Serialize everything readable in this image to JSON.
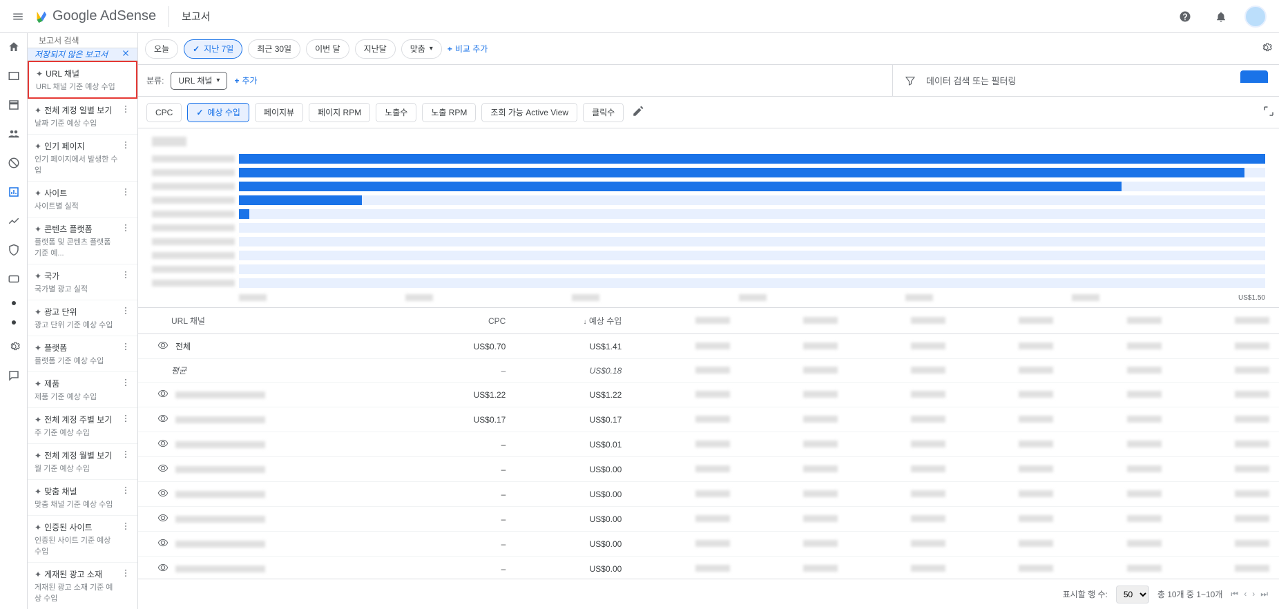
{
  "topbar": {
    "product": "Google AdSense",
    "page_title": "보고서"
  },
  "search": {
    "placeholder": "보고서 검색"
  },
  "unsaved": {
    "label": "저장되지 않은 보고서"
  },
  "reports": [
    {
      "name": "URL 채널",
      "sub": "URL 채널 기준 예상 수입",
      "highlight": true,
      "more": false
    },
    {
      "name": "전체 계정 일별 보기",
      "sub": "날짜 기준 예상 수입",
      "more": true
    },
    {
      "name": "인기 페이지",
      "sub": "인기 페이지에서 발생한 수입",
      "more": true
    },
    {
      "name": "사이트",
      "sub": "사이트별 실적",
      "more": true
    },
    {
      "name": "콘텐츠 플랫폼",
      "sub": "플랫폼 및 콘텐츠 플랫폼 기준 예...",
      "more": true
    },
    {
      "name": "국가",
      "sub": "국가별 광고 실적",
      "more": true
    },
    {
      "name": "광고 단위",
      "sub": "광고 단위 기준 예상 수입",
      "more": true
    },
    {
      "name": "플랫폼",
      "sub": "플랫폼 기준 예상 수입",
      "more": true
    },
    {
      "name": "제품",
      "sub": "제품 기준 예상 수입",
      "more": true
    },
    {
      "name": "전체 계정 주별 보기",
      "sub": "주 기준 예상 수입",
      "more": true
    },
    {
      "name": "전체 계정 월별 보기",
      "sub": "월 기준 예상 수입",
      "more": true
    },
    {
      "name": "맞춤 채널",
      "sub": "맞춤 채널 기준 예상 수입",
      "more": true
    },
    {
      "name": "인증된 사이트",
      "sub": "인증된 사이트 기준 예상 수입",
      "more": true
    },
    {
      "name": "게재된 광고 소재",
      "sub": "게재된 광고 소재 기준 예상 수입",
      "more": true
    }
  ],
  "date_chips": {
    "today": "오늘",
    "last7": "지난 7일",
    "last30": "최근 30일",
    "this_month": "이번 달",
    "last_month": "지난달",
    "custom": "맞춤",
    "add_compare": "비교 추가"
  },
  "breakdown": {
    "label": "분류:",
    "chip": "URL 채널",
    "add": "추가",
    "filter": "데이터 검색 또는 필터링"
  },
  "metrics": {
    "cpc": "CPC",
    "est": "예상 수입",
    "pv": "페이지뷰",
    "prpm": "페이지 RPM",
    "imp": "노출수",
    "irpm": "노출 RPM",
    "av": "조회 가능 Active View",
    "clicks": "클릭수"
  },
  "chart_data": {
    "type": "bar",
    "orientation": "horizontal",
    "xmax_label": "US$1.50",
    "bars": [
      100,
      98,
      86,
      12,
      1,
      0,
      0,
      0,
      0,
      0
    ]
  },
  "table": {
    "headers": {
      "url": "URL 채널",
      "cpc": "CPC",
      "est": "예상 수입"
    },
    "total_row": {
      "name": "전체",
      "cpc": "US$0.70",
      "est": "US$1.41"
    },
    "avg_row": {
      "name": "평균",
      "cpc": "–",
      "est": "US$0.18"
    },
    "rows": [
      {
        "cpc": "US$1.22",
        "est": "US$1.22"
      },
      {
        "cpc": "US$0.17",
        "est": "US$0.17"
      },
      {
        "cpc": "–",
        "est": "US$0.01"
      },
      {
        "cpc": "–",
        "est": "US$0.00"
      },
      {
        "cpc": "–",
        "est": "US$0.00"
      },
      {
        "cpc": "–",
        "est": "US$0.00"
      },
      {
        "cpc": "–",
        "est": "US$0.00"
      },
      {
        "cpc": "–",
        "est": "US$0.00"
      }
    ]
  },
  "pager": {
    "rows_label": "표시할 행 수:",
    "count": "50",
    "range": "총 10개 중 1~10개"
  }
}
